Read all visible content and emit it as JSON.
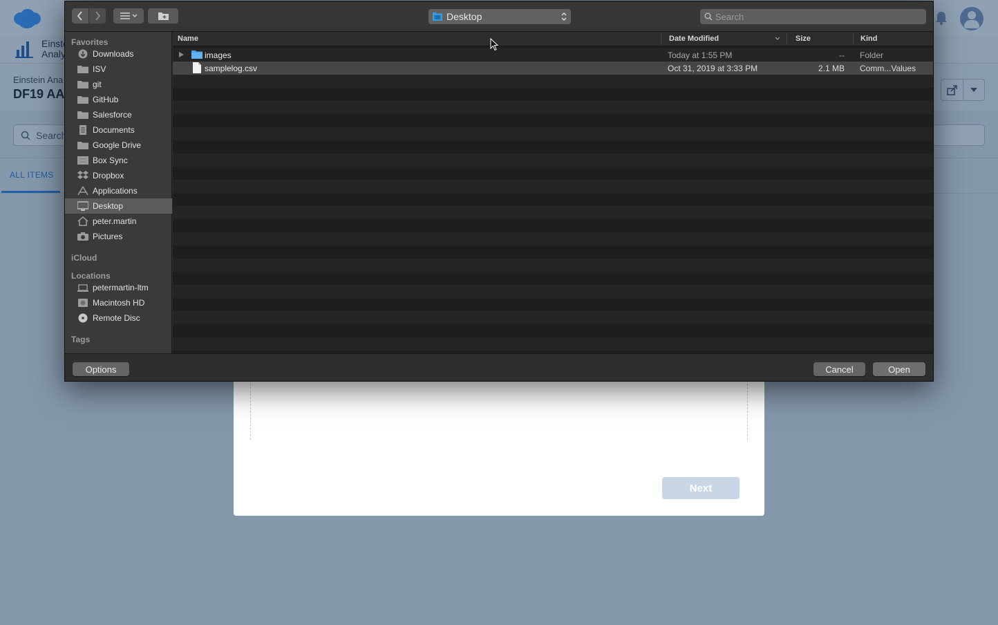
{
  "background_page": {
    "app_name_line1": "Einste",
    "app_name_line2": "Analy",
    "record_label": "Einstein Ana",
    "record_title": "DF19 AA",
    "search_placeholder": "Search",
    "tab_all_items": "ALL ITEMS",
    "next_button": "Next",
    "icons": [
      "salesforce-cloud-icon",
      "bell-icon",
      "avatar-icon",
      "analytics-chart-icon",
      "share-icon",
      "chevron-down-icon"
    ]
  },
  "dialog": {
    "location": "Desktop",
    "search_placeholder": "Search",
    "sidebar": {
      "favorites_label": "Favorites",
      "favorites": [
        {
          "label": "Downloads",
          "icon": "downloads-icon"
        },
        {
          "label": "ISV",
          "icon": "folder-icon"
        },
        {
          "label": "git",
          "icon": "folder-icon"
        },
        {
          "label": "GitHub",
          "icon": "folder-icon"
        },
        {
          "label": "Salesforce",
          "icon": "folder-icon"
        },
        {
          "label": "Documents",
          "icon": "documents-icon"
        },
        {
          "label": "Google Drive",
          "icon": "folder-icon"
        },
        {
          "label": "Box Sync",
          "icon": "box-icon"
        },
        {
          "label": "Dropbox",
          "icon": "dropbox-icon"
        },
        {
          "label": "Applications",
          "icon": "applications-icon"
        },
        {
          "label": "Desktop",
          "icon": "desktop-icon",
          "selected": true
        },
        {
          "label": "peter.martin",
          "icon": "home-icon"
        },
        {
          "label": "Pictures",
          "icon": "camera-icon"
        }
      ],
      "icloud_label": "iCloud",
      "locations_label": "Locations",
      "locations": [
        {
          "label": "petermartin-ltm",
          "icon": "laptop-icon"
        },
        {
          "label": "Macintosh HD",
          "icon": "hard-disk-icon"
        },
        {
          "label": "Remote Disc",
          "icon": "disc-icon"
        }
      ],
      "tags_label": "Tags"
    },
    "columns": {
      "name": "Name",
      "date_modified": "Date Modified",
      "size": "Size",
      "kind": "Kind"
    },
    "files": [
      {
        "name": "images",
        "date": "Today at 1:55 PM",
        "size": "--",
        "kind": "Folder",
        "type": "folder"
      },
      {
        "name": "samplelog.csv",
        "date": "Oct 31, 2019 at 3:33 PM",
        "size": "2.1 MB",
        "kind": "Comm...Values",
        "type": "document",
        "selected": true
      }
    ],
    "buttons": {
      "options": "Options",
      "cancel": "Cancel",
      "open": "Open"
    }
  }
}
